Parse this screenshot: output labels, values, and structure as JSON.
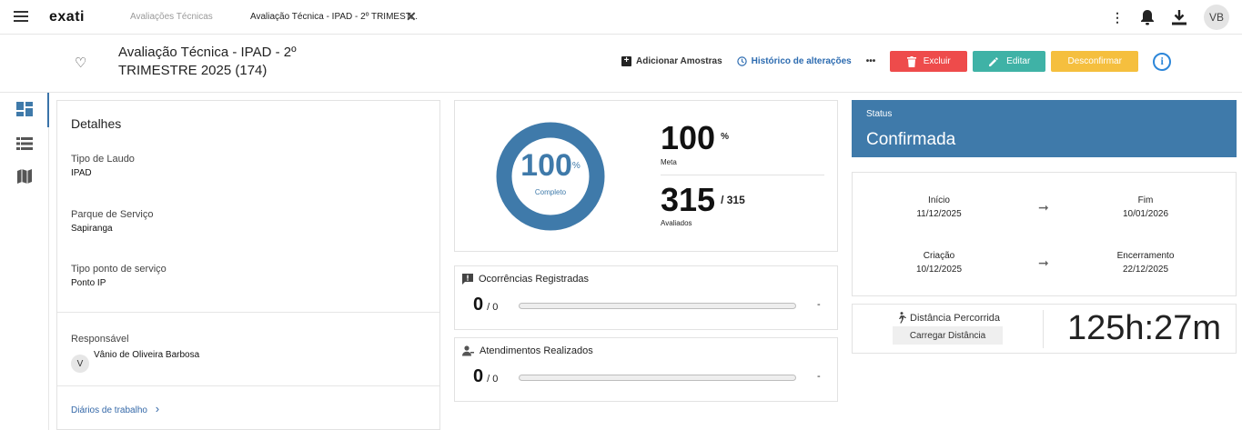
{
  "topbar": {
    "logo": "exati",
    "tabs": [
      {
        "label": "Avaliações Técnicas"
      },
      {
        "label": "Avaliação Técnica - IPAD - 2º TRIMEST..."
      }
    ],
    "close": "✕",
    "kebab": "⋮",
    "avatar": "VB"
  },
  "header": {
    "title": "Avaliação Técnica - IPAD - 2º TRIMESTRE 2025 (174)",
    "actions": {
      "add_samples": "Adicionar Amostras",
      "history": "Histórico de alterações",
      "more": "•••",
      "delete": "Excluir",
      "edit": "Editar",
      "unconfirm": "Desconfirmar",
      "info": "i"
    }
  },
  "details": {
    "heading": "Detalhes",
    "fields": [
      {
        "label": "Tipo de Laudo",
        "value": "IPAD"
      },
      {
        "label": "Parque de Serviço",
        "value": "Sapiranga"
      },
      {
        "label": "Tipo ponto de serviço",
        "value": "Ponto IP"
      }
    ],
    "responsible_label": "Responsável",
    "responsible_initial": "V",
    "responsible_name": "Vânio de Oliveira Barbosa",
    "work_diaries": "Diários de trabalho",
    "chevron": "›"
  },
  "progress": {
    "percent_value": "100",
    "percent_sign": "%",
    "complete_label": "Completo",
    "complete_fraction": 1.0,
    "meta_value": "100",
    "meta_unit": "%",
    "meta_label": "Meta",
    "evaluated_value": "315",
    "evaluated_total": "/ 315",
    "evaluated_label": "Avaliados"
  },
  "occurrences": {
    "title": "Ocorrências Registradas",
    "value": "0",
    "total": "/ 0",
    "dash": "-"
  },
  "services": {
    "title": "Atendimentos Realizados",
    "value": "0",
    "total": "/ 0",
    "dash": "-"
  },
  "status": {
    "label": "Status",
    "value": "Confirmada"
  },
  "dates": {
    "start_label": "Início",
    "start": "11/12/2025",
    "end_label": "Fim",
    "end": "10/01/2026",
    "created_label": "Criação",
    "created": "10/12/2025",
    "closing_label": "Encerramento",
    "closing": "22/12/2025",
    "arrow": "➞"
  },
  "distance": {
    "label": "Distância Percorrida",
    "button": "Carregar Distância",
    "time": "125h:27m"
  },
  "colors": {
    "accent": "#3f7aaa",
    "ring": "#3f7aaa",
    "danger": "#ee4b4b",
    "teal": "#3fb2a6",
    "warning": "#f5bf3e"
  }
}
